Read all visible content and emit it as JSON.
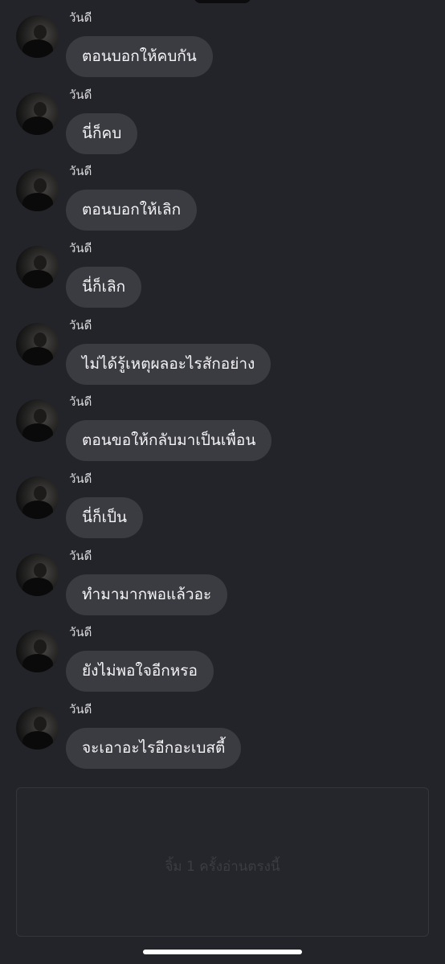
{
  "chat": {
    "messages": [
      {
        "sender": "วันดี",
        "text": "ตอนบอกให้คบกัน"
      },
      {
        "sender": "วันดี",
        "text": "นี่ก็คบ"
      },
      {
        "sender": "วันดี",
        "text": "ตอนบอกให้เลิก"
      },
      {
        "sender": "วันดี",
        "text": "นี่ก็เลิก"
      },
      {
        "sender": "วันดี",
        "text": "ไม่ได้รู้เหตุผลอะไรสักอย่าง"
      },
      {
        "sender": "วันดี",
        "text": "ตอนขอให้กลับมาเป็นเพื่อน"
      },
      {
        "sender": "วันดี",
        "text": "นี่ก็เป็น"
      },
      {
        "sender": "วันดี",
        "text": "ทำมามากพอแล้วอะ"
      },
      {
        "sender": "วันดี",
        "text": "ยังไม่พอใจอีกหรอ"
      },
      {
        "sender": "วันดี",
        "text": "จะเอาอะไรอีกอะเบสตี้"
      }
    ]
  },
  "read_area": {
    "hint": "จิ้ม 1 ครั้งอ่านตรงนี้"
  },
  "colors": {
    "background": "#232429",
    "bubble": "#3b3c42",
    "text": "#f5f5f7",
    "hint_text": "#3c3d42"
  }
}
